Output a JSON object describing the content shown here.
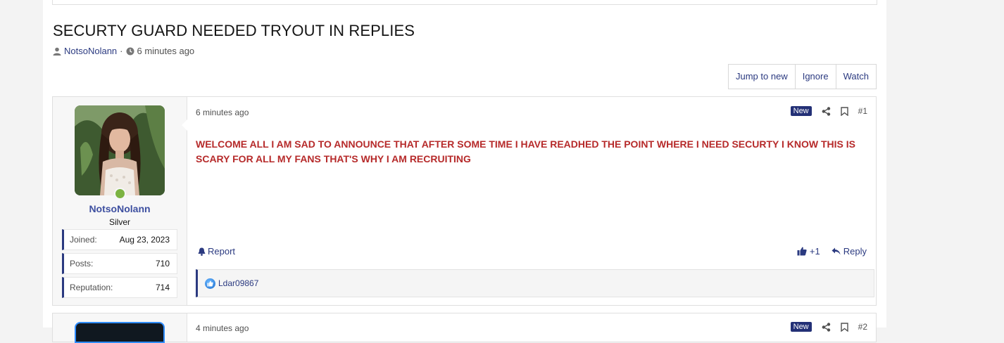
{
  "thread": {
    "title": "SECURTY GUARD NEEDED TRYOUT IN REPLIES",
    "author": "NotsoNolann",
    "separator": "·",
    "time": "6 minutes ago"
  },
  "thread_buttons": {
    "jump": "Jump to new",
    "ignore": "Ignore",
    "watch": "Watch"
  },
  "post1": {
    "username": "NotsoNolann",
    "user_title": "Silver",
    "stats": [
      {
        "label": "Joined:",
        "value": "Aug 23, 2023"
      },
      {
        "label": "Posts:",
        "value": "710"
      },
      {
        "label": "Reputation:",
        "value": "714"
      }
    ],
    "time": "6 minutes ago",
    "new_badge": "New",
    "number": "#1",
    "body": "WELCOME ALL I AM SAD TO ANNOUNCE THAT AFTER SOME TIME I HAVE READHED THE POINT WHERE I NEED SECURTY I KNOW THIS IS SCARY FOR ALL MY FANS THAT'S WHY I AM RECRUITING",
    "report": "Report",
    "like_count": "+1",
    "reply": "Reply",
    "reaction_user": "Ldar09867"
  },
  "post2": {
    "time": "4 minutes ago",
    "new_badge": "New",
    "number": "#2"
  },
  "colors": {
    "accent": "#2b3a80",
    "body_text": "#b62a2a",
    "online": "#7cb342",
    "new_badge": "#233076"
  },
  "icons": [
    "user-icon",
    "clock-icon",
    "share-icon",
    "bookmark-icon",
    "bell-icon",
    "thumbs-up-icon",
    "reply-icon",
    "like-reaction-icon"
  ]
}
